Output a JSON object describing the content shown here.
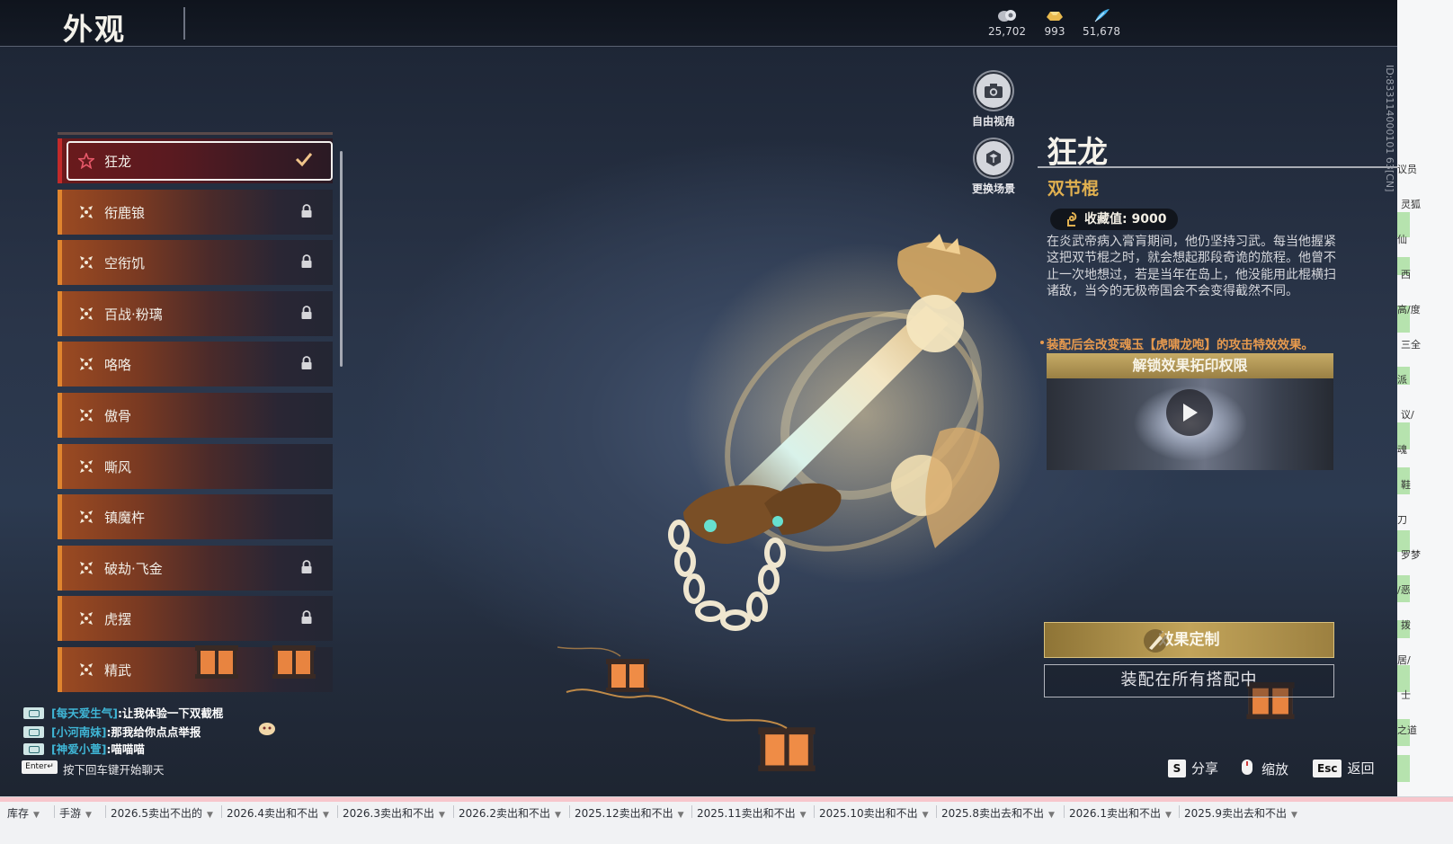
{
  "header": {
    "title": "外观",
    "currencies": [
      {
        "icon": "coin-bag-icon",
        "value": "25,702"
      },
      {
        "icon": "gold-ingot-icon",
        "value": "993"
      },
      {
        "icon": "feather-icon",
        "value": "51,678"
      }
    ]
  },
  "skin_list": {
    "items": [
      {
        "label": "狂龙",
        "selected": true,
        "locked": false
      },
      {
        "label": "衔鹿锒",
        "locked": true
      },
      {
        "label": "空衔饥",
        "locked": true
      },
      {
        "label": "百战·粉璃",
        "locked": true
      },
      {
        "label": "咯咯",
        "locked": true
      },
      {
        "label": "傲骨",
        "locked": false
      },
      {
        "label": "嘶风",
        "locked": false
      },
      {
        "label": "镇魔杵",
        "locked": false
      },
      {
        "label": "破劫·飞金",
        "locked": true
      },
      {
        "label": "虎摆",
        "locked": true
      },
      {
        "label": "精武",
        "locked": false
      }
    ]
  },
  "camera": {
    "free_view": "自由视角",
    "change_scene": "更换场景"
  },
  "detail": {
    "name": "狂龙",
    "type": "双节棍",
    "collect_label": "收藏值: 9000",
    "description": "在炎武帝病入膏肓期间，他仍坚持习武。每当他握紧这把双节棍之时，就会想起那段奇诡的旅程。他曾不止一次地想过，若是当年在岛上，他没能用此棍横扫诸敌，当今的无极帝国会不会变得截然不同。",
    "effect_note": "装配后会改变魂玉【虎啸龙咆】的攻击特效效果。",
    "unlock_header": "解锁效果拓印权限",
    "customize_button": "效果定制",
    "equip_button": "装配在所有搭配中",
    "player_id": "ID:833114000101 63[CN]"
  },
  "chat": {
    "lines": [
      {
        "who": "[每天爱生气]",
        "msg": ":让我体验一下双截棍"
      },
      {
        "who": "[小河南妹]",
        "msg": ":那我给你点点举报"
      },
      {
        "who": "[神爱小萱]",
        "msg": ":喵喵喵"
      }
    ],
    "enter_key": "Enter↵",
    "hint": "按下回车键开始聊天"
  },
  "hotkeys": {
    "share_key": "S",
    "share": "分享",
    "zoom": "缩放",
    "back_key": "Esc",
    "back": "返回"
  },
  "side_strip": {
    "fragments": [
      "议员",
      "灵狐",
      "仙",
      "西",
      "高/度",
      "三全",
      "派",
      "议/",
      "魂",
      "鞋",
      "刀",
      "罗梦",
      "/恶",
      "拨",
      "居/",
      "士",
      "之道"
    ]
  },
  "sheet_tabs": [
    "库存",
    "手游",
    "2026.5卖出不出的",
    "2026.4卖出和不出",
    "2026.3卖出和不出",
    "2026.2卖出和不出",
    "2025.12卖出和不出",
    "2025.11卖出和不出",
    "2025.10卖出和不出",
    "2025.8卖出去和不出",
    "2026.1卖出和不出",
    "2025.9卖出去和不出"
  ],
  "colors": {
    "accent_gold": "#e2b150",
    "effect_orange": "#e79a4e",
    "list_orange": "#e0852e",
    "selected_red": "#c22a2a",
    "chat_name": "#3fb6d6"
  }
}
